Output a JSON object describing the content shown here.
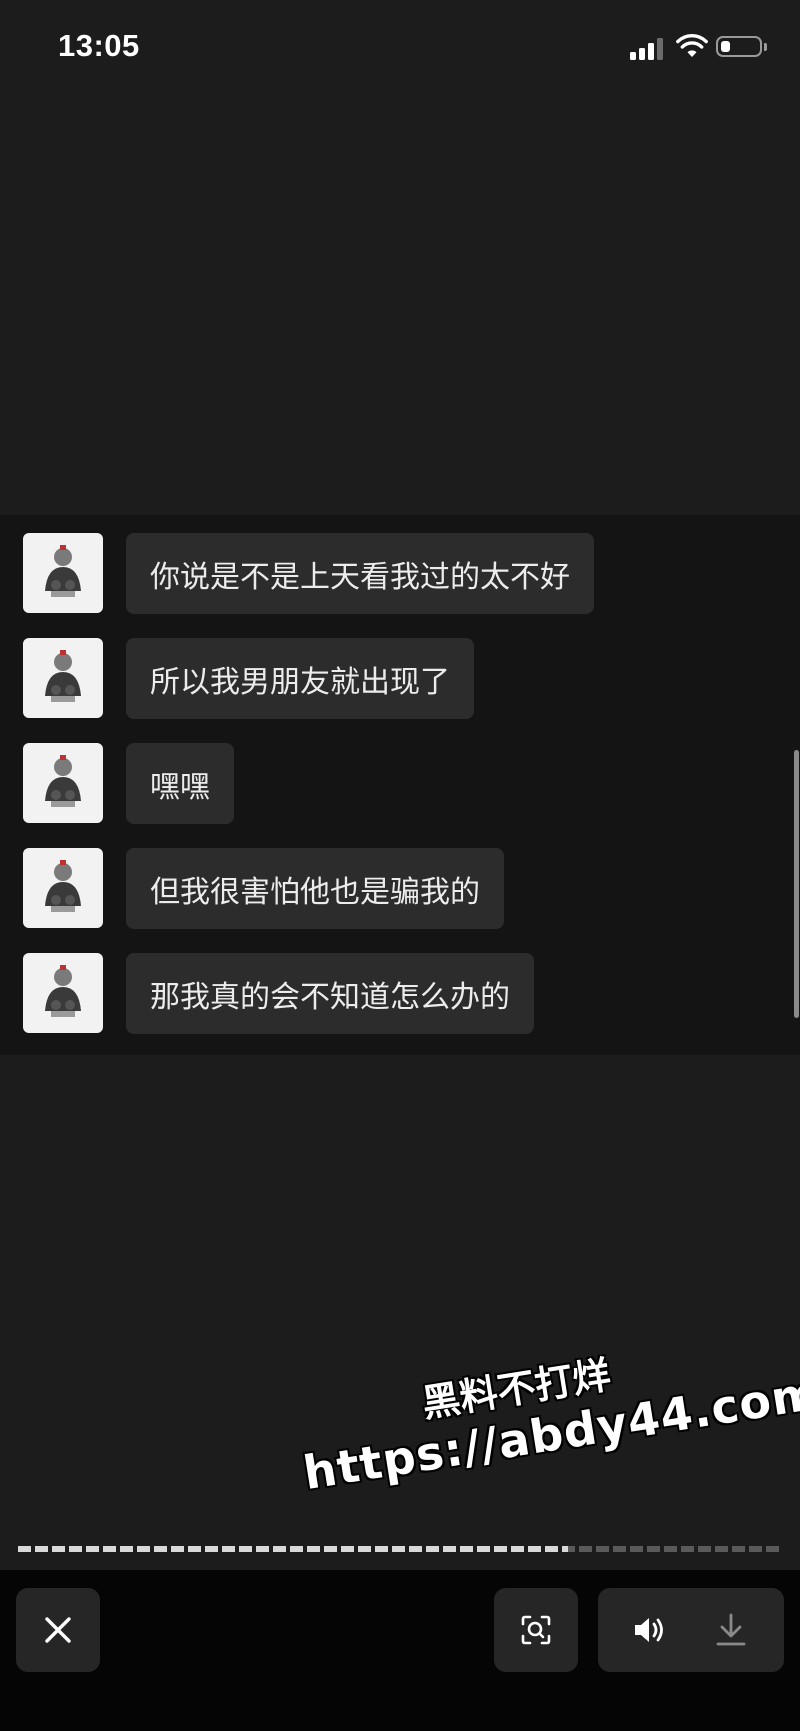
{
  "status_bar": {
    "time": "13:05"
  },
  "chat": {
    "messages": [
      {
        "text": "你说是不是上天看我过的太不好"
      },
      {
        "text": "所以我男朋友就出现了"
      },
      {
        "text": "嘿嘿"
      },
      {
        "text": "但我很害怕他也是骗我的"
      },
      {
        "text": "那我真的会不知道怎么办的"
      }
    ]
  },
  "watermark": {
    "title": "黑料不打烊",
    "url": "https://abdy44.com"
  },
  "playback": {
    "progress_fraction": 0.72
  },
  "controls": {
    "icons": [
      "close-icon",
      "scan-icon",
      "speaker-icon",
      "download-icon"
    ]
  },
  "colors": {
    "background": "#1c1c1c",
    "chat_panel": "#141414",
    "bubble": "#2c2c2c",
    "control_bar": "#050505"
  }
}
